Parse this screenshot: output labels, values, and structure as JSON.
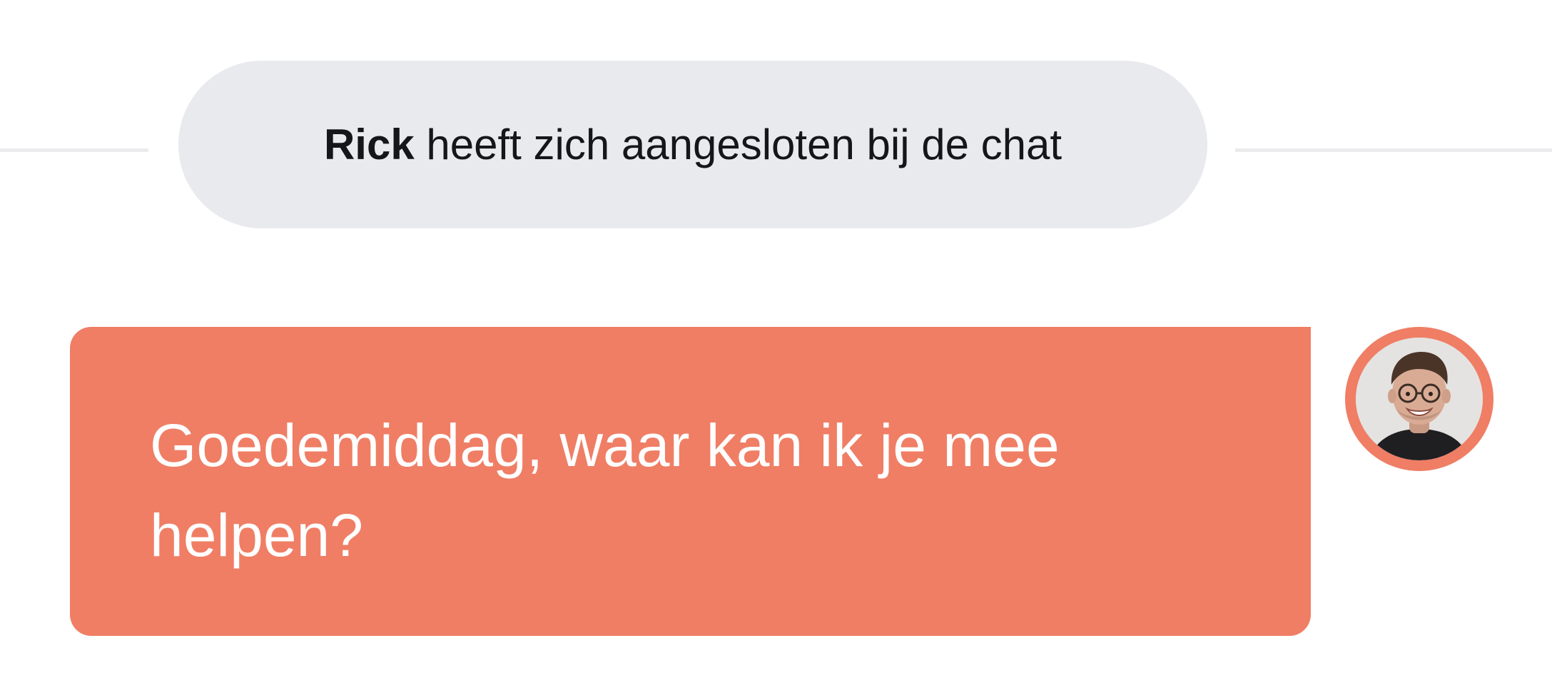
{
  "system_notice": {
    "name": "Rick",
    "text": "heeft zich aangesloten bij de chat"
  },
  "message": {
    "text": "Goedemiddag, waar kan ik je mee helpen?"
  },
  "avatar": {
    "icon": "agent-avatar"
  },
  "colors": {
    "bubble": "#ef7e65",
    "pill": "#e9eaee",
    "divider": "#ebebed"
  }
}
